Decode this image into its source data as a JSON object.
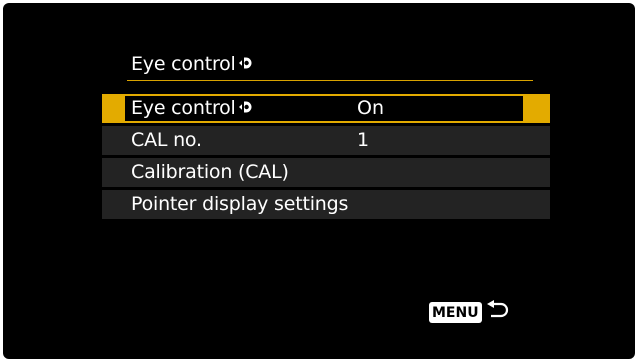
{
  "screen": {
    "title": "Eye control",
    "title_icon": "eye-control-icon",
    "accent_color": "#e3ab00"
  },
  "menu": {
    "items": [
      {
        "label": "Eye control",
        "icon": "eye-control-icon",
        "value": "On",
        "selected": true
      },
      {
        "label": "CAL no.",
        "value": "1",
        "selected": false
      },
      {
        "label": "Calibration (CAL)",
        "value": "",
        "selected": false
      },
      {
        "label": "Pointer display settings",
        "value": "",
        "selected": false
      }
    ]
  },
  "footer": {
    "menu_label": "MENU",
    "return_icon": "return-arrow-icon"
  }
}
